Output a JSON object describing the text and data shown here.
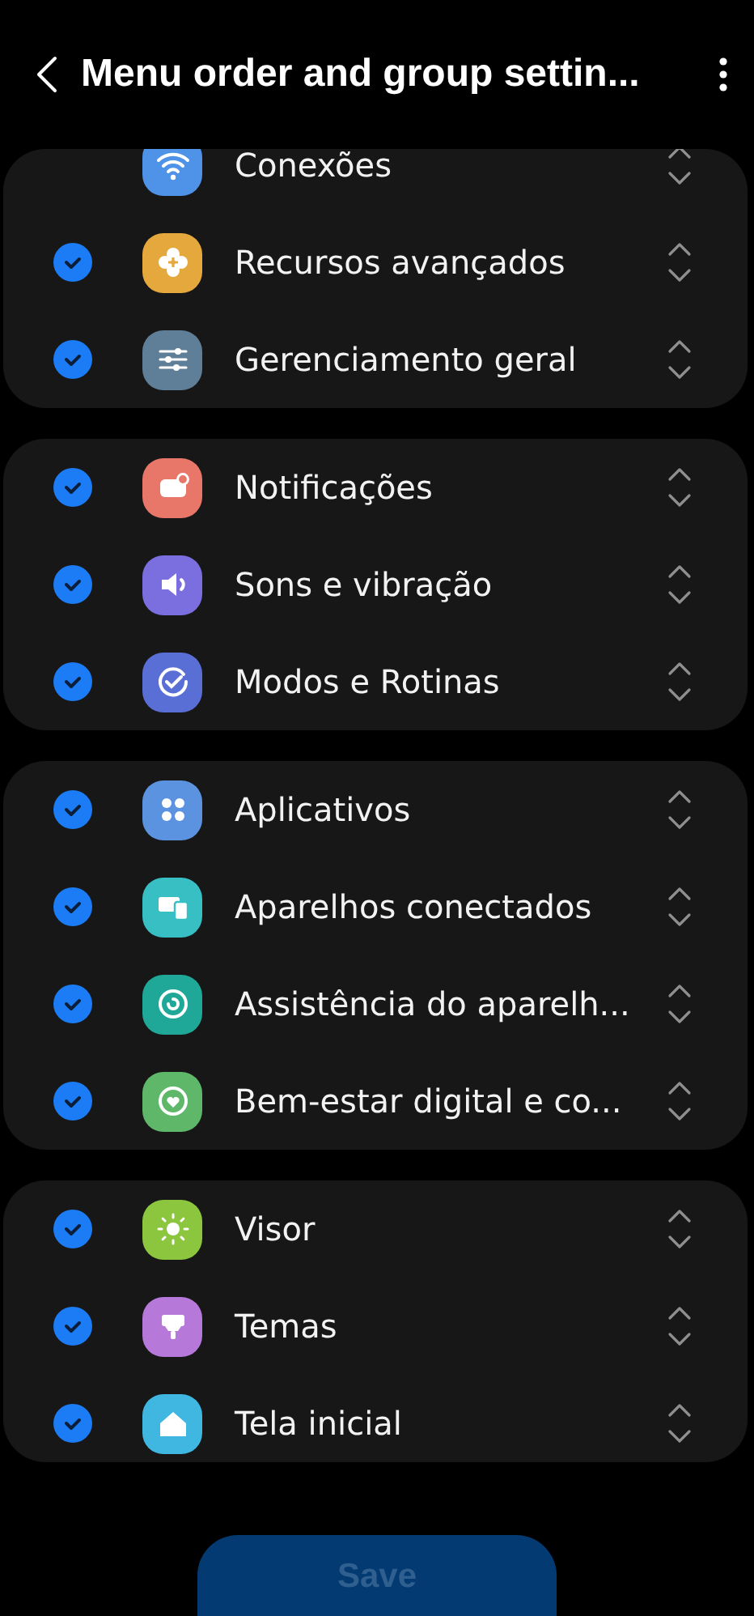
{
  "header": {
    "title": "Menu order and group settin..."
  },
  "groups": [
    {
      "items": [
        {
          "kind": "fixed",
          "label": "Conexões",
          "color": "#4e93e8"
        },
        {
          "kind": "toggle",
          "checked": true,
          "label": "Recursos avançados",
          "color": "#e5a83c"
        },
        {
          "kind": "toggle",
          "checked": true,
          "label": "Gerenciamento geral",
          "color": "#5f7f99"
        }
      ]
    },
    {
      "items": [
        {
          "kind": "toggle",
          "checked": true,
          "label": "Notificações",
          "color": "#e8776a"
        },
        {
          "kind": "toggle",
          "checked": true,
          "label": "Sons e vibração",
          "color": "#7b6fe0"
        },
        {
          "kind": "toggle",
          "checked": true,
          "label": "Modos e Rotinas",
          "color": "#5a6fd6"
        }
      ]
    },
    {
      "items": [
        {
          "kind": "toggle",
          "checked": true,
          "label": "Aplicativos",
          "color": "#5b93e0"
        },
        {
          "kind": "toggle",
          "checked": true,
          "label": "Aparelhos conectados",
          "color": "#37bfc4"
        },
        {
          "kind": "toggle",
          "checked": true,
          "label": "Assistência do aparelh...",
          "color": "#1fa898"
        },
        {
          "kind": "toggle",
          "checked": true,
          "label": "Bem-estar digital e co...",
          "color": "#5fb86a"
        }
      ]
    },
    {
      "items": [
        {
          "kind": "toggle",
          "checked": true,
          "label": "Visor",
          "color": "#8cc63f"
        },
        {
          "kind": "toggle",
          "checked": true,
          "label": "Temas",
          "color": "#b679d9"
        },
        {
          "kind": "toggle",
          "checked": true,
          "label": "Tela inicial",
          "color": "#3fb7e0"
        }
      ]
    }
  ],
  "save_button": {
    "label": "Save",
    "disabled": true
  }
}
